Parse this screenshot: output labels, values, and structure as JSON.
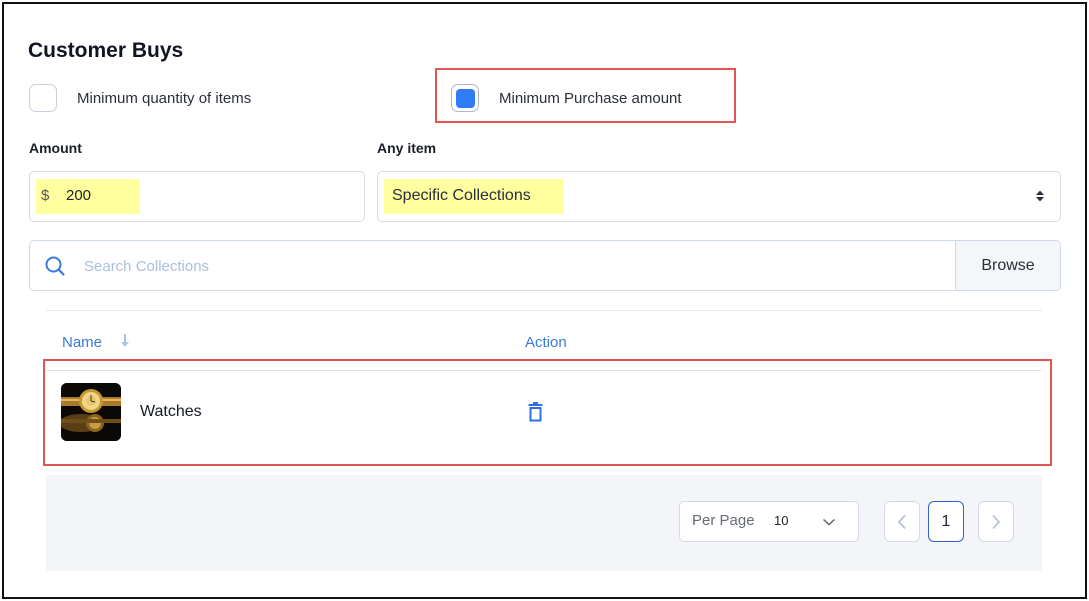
{
  "section": {
    "title": "Customer Buys"
  },
  "options": {
    "min_quantity_label": "Minimum quantity of items",
    "min_quantity_checked": false,
    "min_purchase_label": "Minimum Purchase amount",
    "min_purchase_checked": true
  },
  "amount": {
    "label": "Amount",
    "currency": "$",
    "value": "200"
  },
  "applies_to": {
    "label": "Any item",
    "selected": "Specific Collections"
  },
  "search": {
    "placeholder": "Search Collections",
    "browse_label": "Browse"
  },
  "table": {
    "columns": {
      "name": "Name",
      "action": "Action"
    },
    "rows": [
      {
        "name": "Watches",
        "thumbnail": "gold-watches-image",
        "action_icon": "trash-icon"
      }
    ]
  },
  "pagination": {
    "per_page_label": "Per Page",
    "per_page_value": "10",
    "current_page": "1"
  },
  "colors": {
    "accent": "#2f7cf6",
    "link_blue": "#3a7ad8",
    "highlight_red": "#e25555",
    "highlight_yellow": "#ffffa0"
  }
}
